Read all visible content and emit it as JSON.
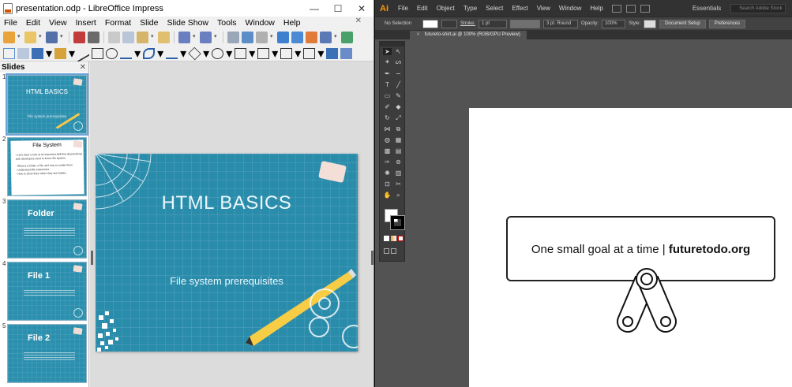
{
  "libreoffice": {
    "window_title": "presentation.odp - LibreOffice Impress",
    "window_controls": [
      "—",
      "☐",
      "✕"
    ],
    "menu": [
      "File",
      "Edit",
      "View",
      "Insert",
      "Format",
      "Slide",
      "Slide Show",
      "Tools",
      "Window",
      "Help"
    ],
    "close_doc": "✕",
    "slides_pane_title": "Slides",
    "slides_pane_close": "✕",
    "slides": [
      {
        "num": "1",
        "title": "HTML BASICS",
        "subtitle": "File system prerequisites"
      },
      {
        "num": "2",
        "title": "File System",
        "lines": [
          "• Let's have a look at an important skill that all practicing",
          "  web developers need to know: file system.",
          "- What is a folder, a file, and how to create them",
          "- Understand file extensions",
          "- How to show them when they are hidden."
        ]
      },
      {
        "num": "3",
        "title": "Folder"
      },
      {
        "num": "4",
        "title": "File 1"
      },
      {
        "num": "5",
        "title": "File 2"
      }
    ],
    "current_slide": {
      "title": "HTML BASICS",
      "subtitle": "File system prerequisites"
    }
  },
  "illustrator": {
    "logo": "Ai",
    "menu": [
      "File",
      "Edit",
      "Object",
      "Type",
      "Select",
      "Effect",
      "View",
      "Window",
      "Help"
    ],
    "workspace": "Essentials",
    "search_placeholder": "Search Adobe Stock",
    "control_bar": {
      "selection": "No Selection",
      "stroke_label": "Stroke:",
      "stroke_value": "1 pt",
      "brush": "3 pt. Round",
      "opacity_label": "Opacity:",
      "opacity_value": "100%",
      "style_label": "Style:",
      "document_setup": "Document Setup",
      "preferences": "Preferences"
    },
    "tab": {
      "close": "✕",
      "label": "futureto-shirt.ai @ 100% (RGB/GPU Preview)"
    },
    "artwork": {
      "text_regular": "One small goal at a time | ",
      "text_bold": "futuretodo.org"
    },
    "colors": {
      "fill": "#ffffff",
      "stroke": "#000000",
      "accent": "#ff9a00"
    }
  }
}
